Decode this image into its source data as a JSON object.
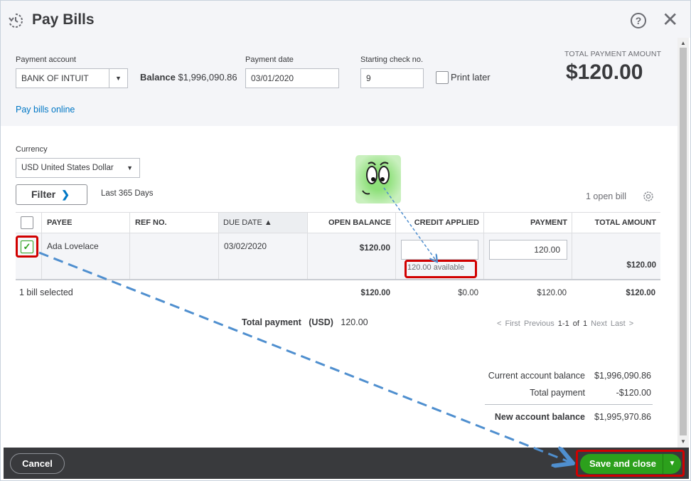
{
  "dialog": {
    "title": "Pay Bills",
    "help_icon": "help-icon",
    "close_icon": "close-icon"
  },
  "payment": {
    "account_label": "Payment account",
    "account_value": "BANK OF INTUIT",
    "balance_label": "Balance",
    "balance_value": "$1,996,090.86",
    "date_label": "Payment date",
    "date_value": "03/01/2020",
    "check_label": "Starting check no.",
    "check_value": "9",
    "print_later_label": "Print later",
    "total_label": "TOTAL PAYMENT AMOUNT",
    "total_value": "$120.00",
    "pay_online_link": "Pay bills online"
  },
  "filters": {
    "currency_label": "Currency",
    "currency_value": "USD United States Dollar",
    "filter_button": "Filter",
    "range_text": "Last 365 Days",
    "open_bill_count": "1 open bill"
  },
  "table": {
    "headers": [
      "PAYEE",
      "REF NO.",
      "DUE DATE ▲",
      "OPEN BALANCE",
      "CREDIT APPLIED",
      "PAYMENT",
      "TOTAL AMOUNT"
    ],
    "row": {
      "payee": "Ada Lovelace",
      "ref_no": "",
      "due_date": "03/02/2020",
      "open_balance": "$120.00",
      "credit_available": "120.00 available",
      "payment": "120.00",
      "total_amount": "$120.00"
    },
    "totals": {
      "selected": "1 bill selected",
      "open_balance": "$120.00",
      "credit_applied": "$0.00",
      "payment": "$120.00",
      "total_amount": "$120.00"
    }
  },
  "total_payment": {
    "label": "Total payment",
    "currency": "(USD)",
    "value": "120.00"
  },
  "pager": {
    "first": "< First",
    "previous": "Previous",
    "range": "1-1 of 1",
    "next": "Next",
    "last": "Last >"
  },
  "summary": {
    "current_label": "Current account balance",
    "current_value": "$1,996,090.86",
    "payment_label": "Total payment",
    "payment_value": "-$120.00",
    "new_label": "New account balance",
    "new_value": "$1,995,970.86"
  },
  "footer": {
    "cancel": "Cancel",
    "save": "Save and close"
  },
  "colors": {
    "accent_green": "#2ca01c",
    "link_blue": "#0077c5",
    "highlight_red": "#d10000",
    "annotation_blue": "#4f8fcf"
  }
}
